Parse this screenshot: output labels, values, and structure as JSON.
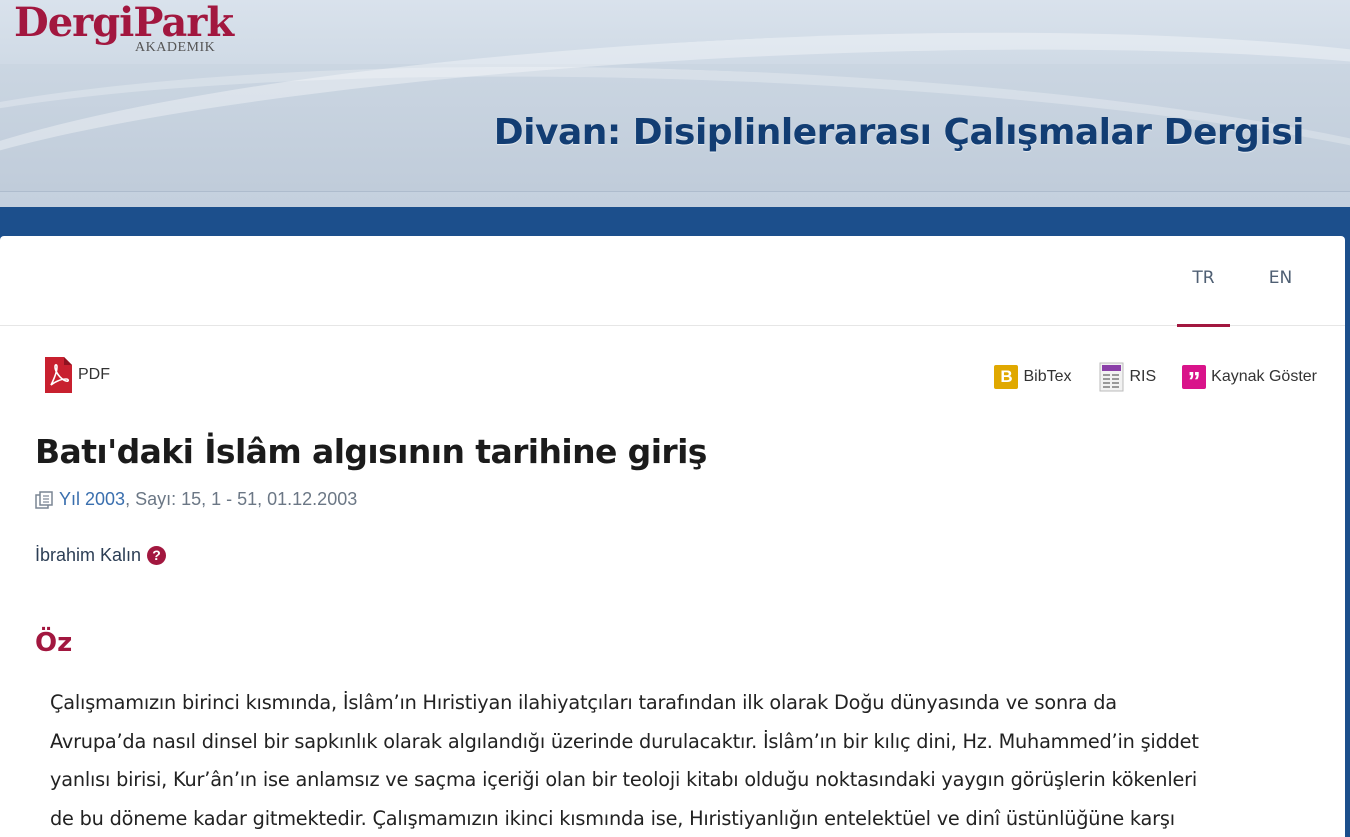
{
  "brand": {
    "logo_main": "DergiPark",
    "logo_sub": "AKADEMIK"
  },
  "journal": {
    "title": "Divan: Disiplinlerarası Çalışmalar Dergisi"
  },
  "languages": {
    "tr": "TR",
    "en": "EN",
    "active": "TR"
  },
  "tools": {
    "pdf": "PDF",
    "bibtex": "BibTex",
    "ris": "RIS",
    "cite": "Kaynak Göster",
    "bibtex_icon_letter": "B",
    "cite_icon_glyph": "”"
  },
  "article": {
    "title": "Batı'daki İslâm algısının tarihine giriş",
    "year_link": "Yıl 2003",
    "meta_rest": ", Sayı: 15, 1 - 51, 01.12.2003",
    "author": "İbrahim Kalın",
    "author_help_glyph": "?"
  },
  "abstract": {
    "heading": "Öz",
    "lines": [
      "Çalışmamızın birinci kısmında, İslâm’ın Hıristiyan ilahiyatçıları tarafından ilk olarak Doğu dünyasında ve sonra da",
      "Avrupa’da nasıl dinsel bir sapkınlık olarak algılandığı üzerinde durulacaktır. İslâm’ın bir kılıç dini, Hz. Muhammed’in şiddet",
      "yanlısı birisi, Kur’ân’ın ise anlamsız ve saçma içeriği olan bir teoloji kitabı olduğu noktasındaki yaygın görüşlerin kökenleri",
      "de bu döneme kadar gitmektedir. Çalışmamızın ikinci kısmında ise, Hıristiyanlığın entelektüel ve dinî üstünlüğüne karşı"
    ]
  },
  "colors": {
    "brand": "#a2173f",
    "header_band": "#c4d0de",
    "nav_blue": "#1c4f8c",
    "journal_title": "#123d73",
    "link": "#3a6fae",
    "bibtex": "#e0a800",
    "cite": "#d9138a"
  },
  "icons": [
    "pdf-icon",
    "bibtex-icon",
    "ris-icon",
    "cite-icon",
    "copy-icon",
    "help-icon"
  ]
}
